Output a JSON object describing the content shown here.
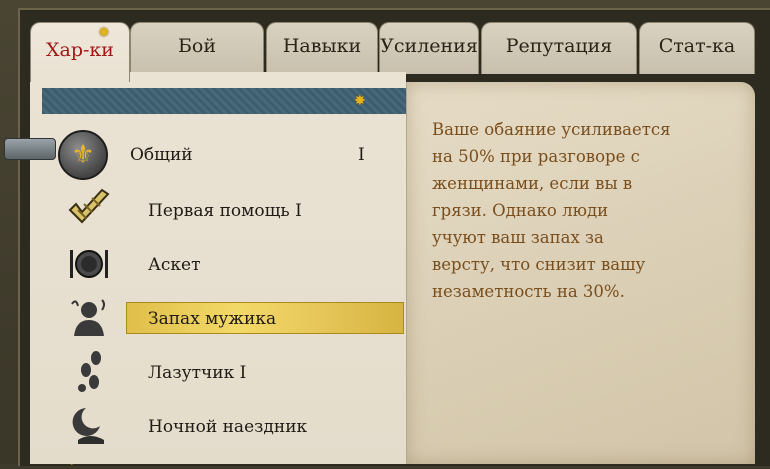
{
  "tabs": [
    {
      "label": "Хар-ки",
      "active": true
    },
    {
      "label": "Бой"
    },
    {
      "label": "Навыки"
    },
    {
      "label": "Усиления"
    },
    {
      "label": "Репутация"
    },
    {
      "label": "Стат-ка"
    }
  ],
  "category": {
    "label": "Общий",
    "level": "I",
    "icon": "fleur-de-lis-icon"
  },
  "perks": [
    {
      "label": "Первая помощь I",
      "icon": "bandage-icon"
    },
    {
      "label": "Аскет",
      "icon": "plate-fork-icon"
    },
    {
      "label": "Запах мужика",
      "icon": "stench-icon",
      "selected": true
    },
    {
      "label": "Лазутчик I",
      "icon": "footprints-icon"
    },
    {
      "label": "Ночной наездник",
      "icon": "moon-rider-icon"
    }
  ],
  "description": "Ваше обаяние усиливается\nна 50% при разговоре с\nженщинами, если вы в\nгрязи. Однако люди\nучуют ваш запах за\nверсту, что снизит вашу\nнезаметность на 30%.",
  "colors": {
    "accent_tab": "#a01818",
    "description_text": "#7a4e1c",
    "highlight": "#f3d968"
  }
}
